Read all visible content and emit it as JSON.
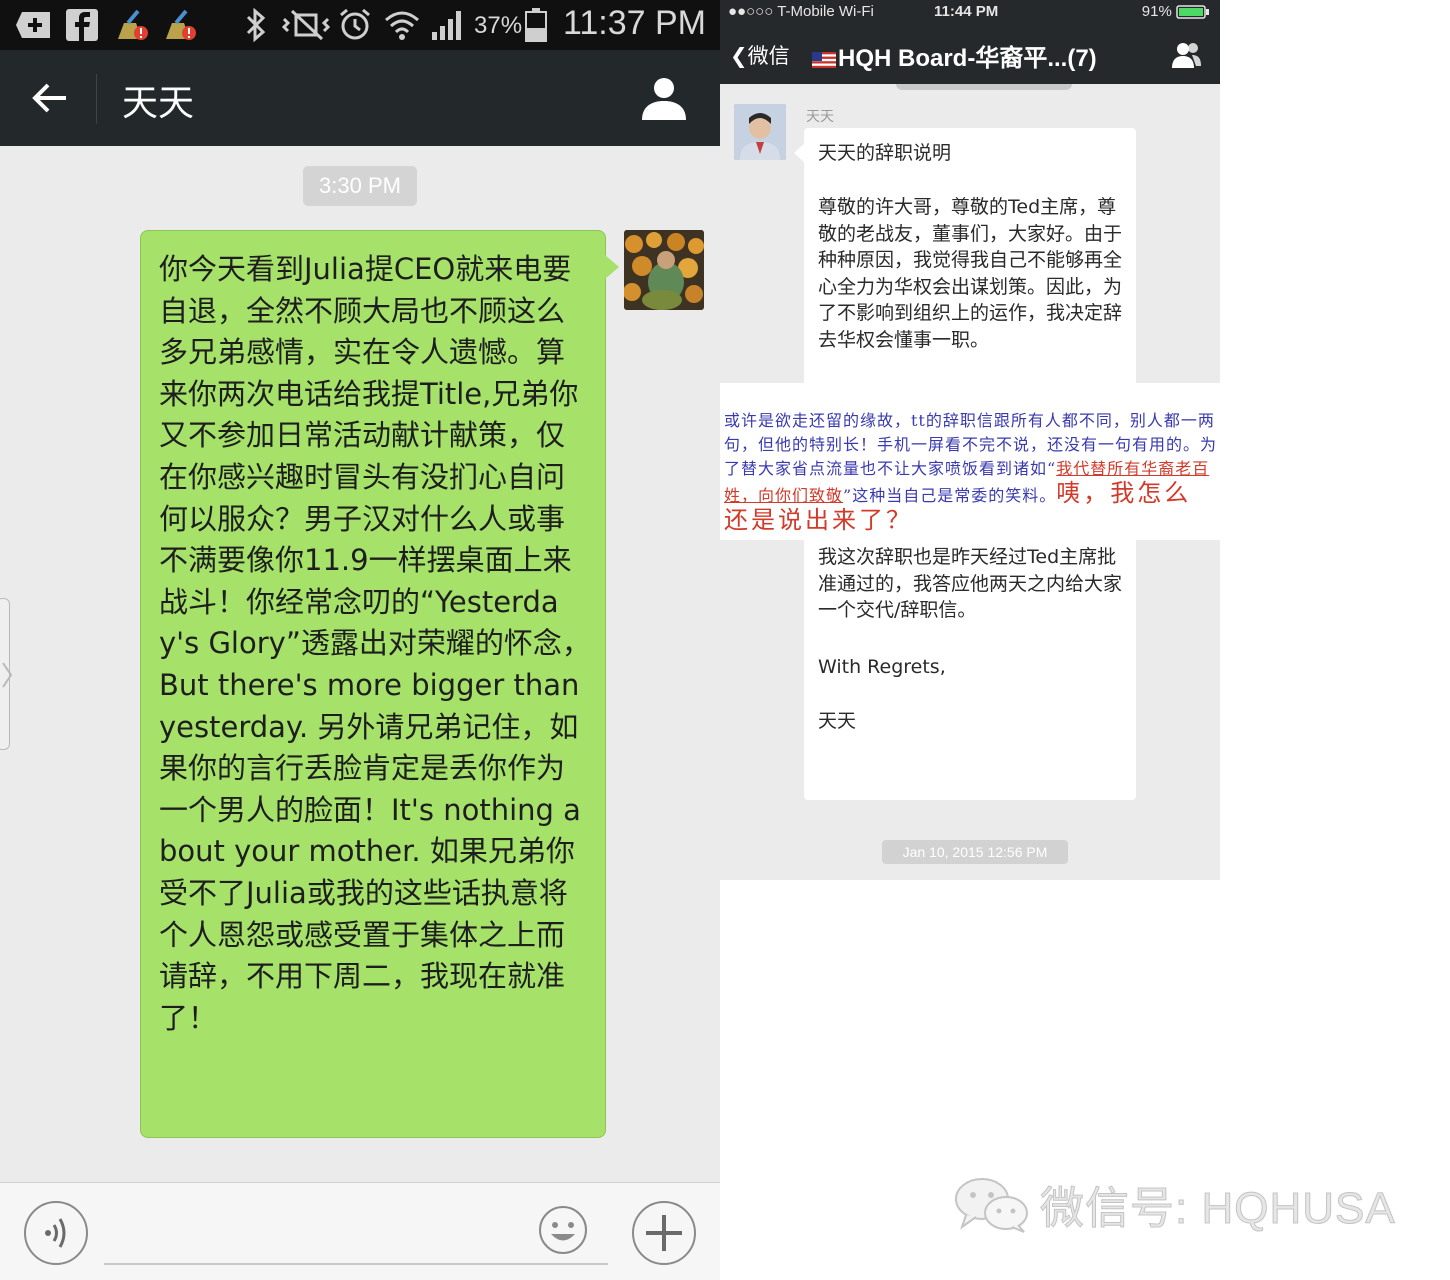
{
  "android": {
    "status_bar": {
      "battery_percent": "37%",
      "time": "11:37 PM"
    },
    "header": {
      "title": "天天"
    },
    "timestamp": "3:30 PM",
    "message": "你今天看到Julia提CEO就来电要自退，全然不顾大局也不顾这么多兄弟感情，实在令人遗憾。算来你两次电话给我提Title,兄弟你又不参加日常活动献计献策，仅在你感兴趣时冒头有没扪心自问何以服众？男子汉对什么人或事不满要像你11.9一样摆桌面上来战斗！你经常念叨的“Yesterday's Glory”透露出对荣耀的怀念，But there's more bigger than yesterday. 另外请兄弟记住，如果你的言行丢脸肯定是丢你作为一个男人的脸面！It's nothing about your mother. 如果兄弟你受不了Julia或我的这些话执意将个人恩怨或感受置于集体之上而请辞，不用下周二，我现在就准了！",
    "colors": {
      "bubble": "#a6e26a",
      "header": "#23292a"
    }
  },
  "ios": {
    "status_bar": {
      "carrier": "●●○○○ T-Mobile Wi-Fi",
      "time": "11:44 PM",
      "battery": "91%"
    },
    "nav": {
      "back_label": "微信",
      "title": "HQH Board-华裔平...(7)"
    },
    "sender_name": "天天",
    "card": {
      "heading": "天天的辞职说明",
      "para1": "尊敬的许大哥，尊敬的Ted主席，尊敬的老战友，董事们，大家好。由于种种原因，我觉得我自己不能够再全心全力为华权会出谋划策。因此，为了不影响到组织上的运作，我决定辞去华权会懂事一职。",
      "para2": "我这次辞职也是昨天经过Ted主席批准通过的，我答应他两天之内给大家一个交代/辞职信。",
      "closing": "With Regrets,",
      "signature": "天天"
    },
    "date_pill": "Jan 10, 2015 12:56 PM"
  },
  "annotation": {
    "part1": "或许是欲走还留的缘故，tt的辞职信跟所有人都不同，别人都一两句，但他的特别长！手机一屏看不完不说，还没有一句有用的。为了替大家省点流量也不让大家喷饭看到诸如“",
    "quote": "我代替所有华裔老百姓，向你们致敬",
    "part2": "”这种当自己是常委的笑料。",
    "exclaim": "咦，我怎么还是说出来了？"
  },
  "watermark": {
    "text": "微信号: HQHUSA"
  }
}
